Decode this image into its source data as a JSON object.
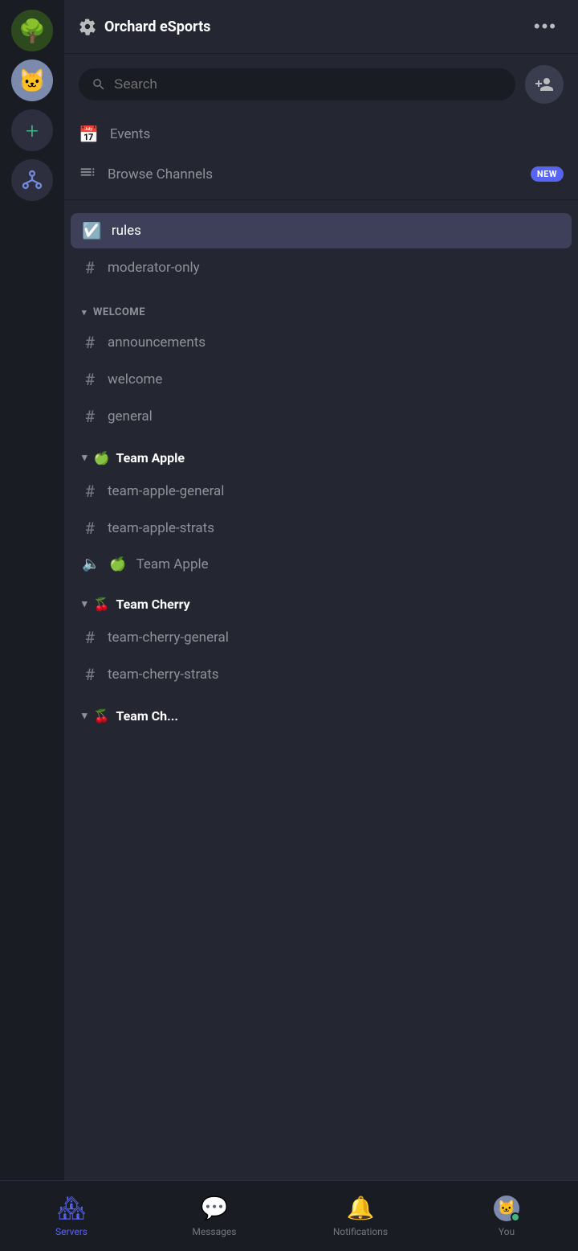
{
  "serverList": {
    "servers": [
      {
        "id": "orchard",
        "emoji": "🌳",
        "bg": "#2d4a1e",
        "label": "Orchard eSports"
      },
      {
        "id": "cat",
        "emoji": "🐱",
        "bg": "#7b8aad",
        "label": "Cat Server"
      }
    ],
    "addLabel": "+",
    "hierarchyLabel": "⊕"
  },
  "header": {
    "gearSymbol": "⚙",
    "title": "Orchard eSports",
    "dotsLabel": "•••"
  },
  "search": {
    "placeholder": "Search",
    "addUserSymbol": "👤+"
  },
  "navItems": [
    {
      "id": "events",
      "icon": "📅",
      "label": "Events"
    },
    {
      "id": "browse",
      "icon": "☰",
      "label": "Browse Channels",
      "badge": "NEW"
    }
  ],
  "topChannels": [
    {
      "id": "rules",
      "icon": "✅",
      "label": "rules",
      "active": true
    },
    {
      "id": "moderator-only",
      "icon": "#",
      "label": "moderator-only",
      "active": false
    }
  ],
  "categories": [
    {
      "id": "welcome",
      "label": "welcome",
      "bold": false,
      "emoji": "",
      "channels": [
        {
          "id": "announcements",
          "type": "text",
          "label": "announcements"
        },
        {
          "id": "welcome",
          "type": "text",
          "label": "welcome"
        },
        {
          "id": "general",
          "type": "text",
          "label": "general"
        }
      ]
    },
    {
      "id": "team-apple",
      "label": "Team Apple",
      "bold": true,
      "emoji": "🍏",
      "channels": [
        {
          "id": "team-apple-general",
          "type": "text",
          "label": "team-apple-general"
        },
        {
          "id": "team-apple-strats",
          "type": "text",
          "label": "team-apple-strats"
        },
        {
          "id": "team-apple-voice",
          "type": "voice",
          "label": "Team Apple",
          "emoji": "🍏"
        }
      ]
    },
    {
      "id": "team-cherry",
      "label": "Team Cherry",
      "bold": true,
      "emoji": "🍒",
      "channels": [
        {
          "id": "team-cherry-general",
          "type": "text",
          "label": "team-cherry-general"
        },
        {
          "id": "team-cherry-strats",
          "type": "text",
          "label": "team-cherry-strats"
        }
      ]
    }
  ],
  "partialCategory": {
    "emoji": "🍒",
    "label": "Team Ch..."
  },
  "bottomNav": {
    "tabs": [
      {
        "id": "servers",
        "icon": "🏘",
        "label": "Servers",
        "active": true
      },
      {
        "id": "messages",
        "icon": "💬",
        "label": "Messages",
        "active": false
      },
      {
        "id": "notifications",
        "icon": "🔔",
        "label": "Notifications",
        "active": false
      },
      {
        "id": "you",
        "label": "You",
        "active": false,
        "isAvatar": true,
        "emoji": "🐱"
      }
    ]
  }
}
